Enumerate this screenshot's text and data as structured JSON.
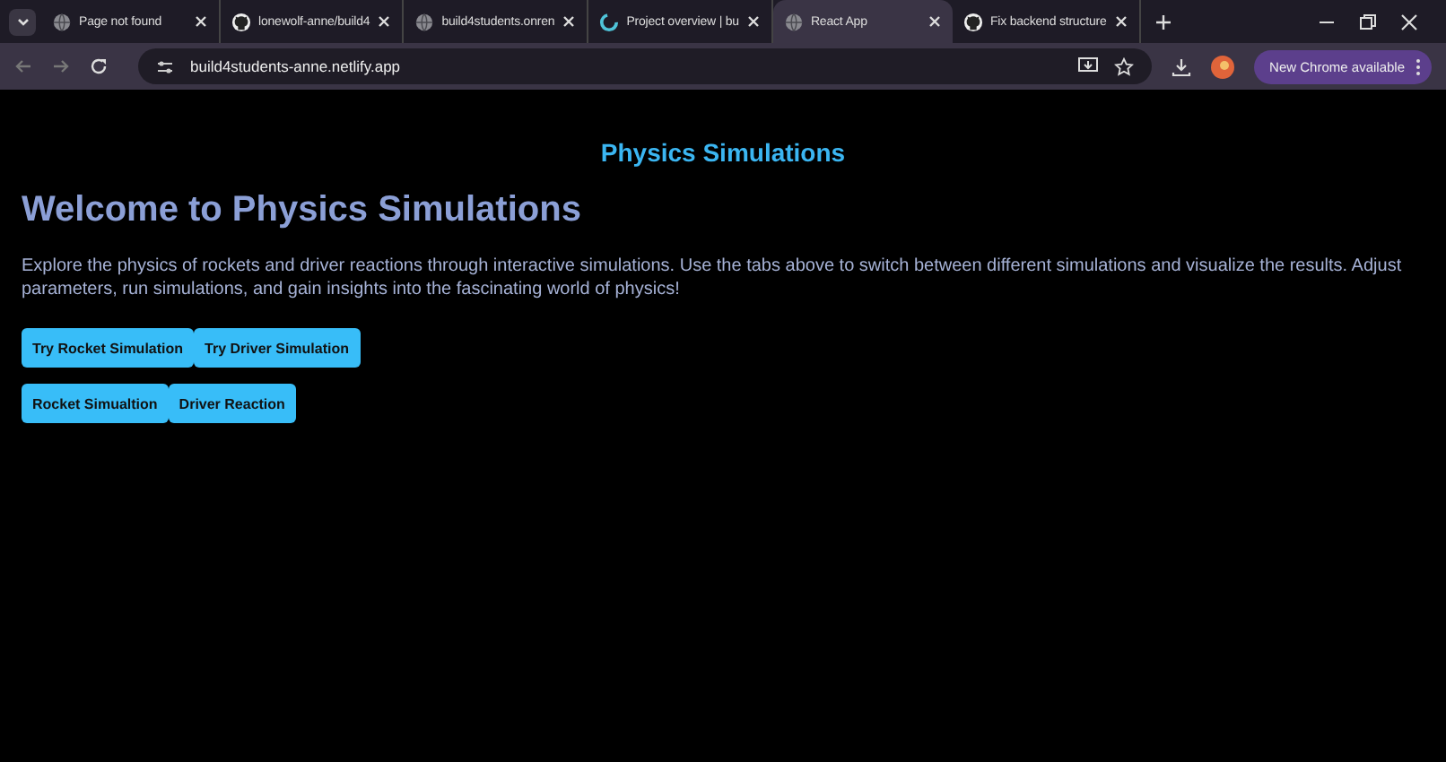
{
  "browser": {
    "tabs": [
      {
        "title": "Page not found",
        "kind": "globe",
        "selected": false
      },
      {
        "title": "lonewolf-anne/build4",
        "kind": "github",
        "selected": false
      },
      {
        "title": "build4students.onren",
        "kind": "globe",
        "selected": false
      },
      {
        "title": "Project overview | bu",
        "kind": "netlify",
        "selected": false
      },
      {
        "title": "React App",
        "kind": "globe",
        "selected": true
      },
      {
        "title": "Fix backend structure",
        "kind": "github",
        "selected": false
      }
    ],
    "address": "build4students-anne.netlify.app",
    "update_button": "New Chrome available"
  },
  "page": {
    "header": "Physics Simulations",
    "heading": "Welcome to Physics Simulations",
    "intro": "Explore the physics of rockets and driver reactions through interactive simulations. Use the tabs above to switch between different simulations and visualize the results. Adjust parameters, run simulations, and gain insights into the fascinating world of physics!",
    "action_buttons": [
      "Try Rocket Simulation",
      "Try Driver Simulation"
    ],
    "tabs": [
      "Rocket Simualtion",
      "Driver Reaction"
    ]
  }
}
